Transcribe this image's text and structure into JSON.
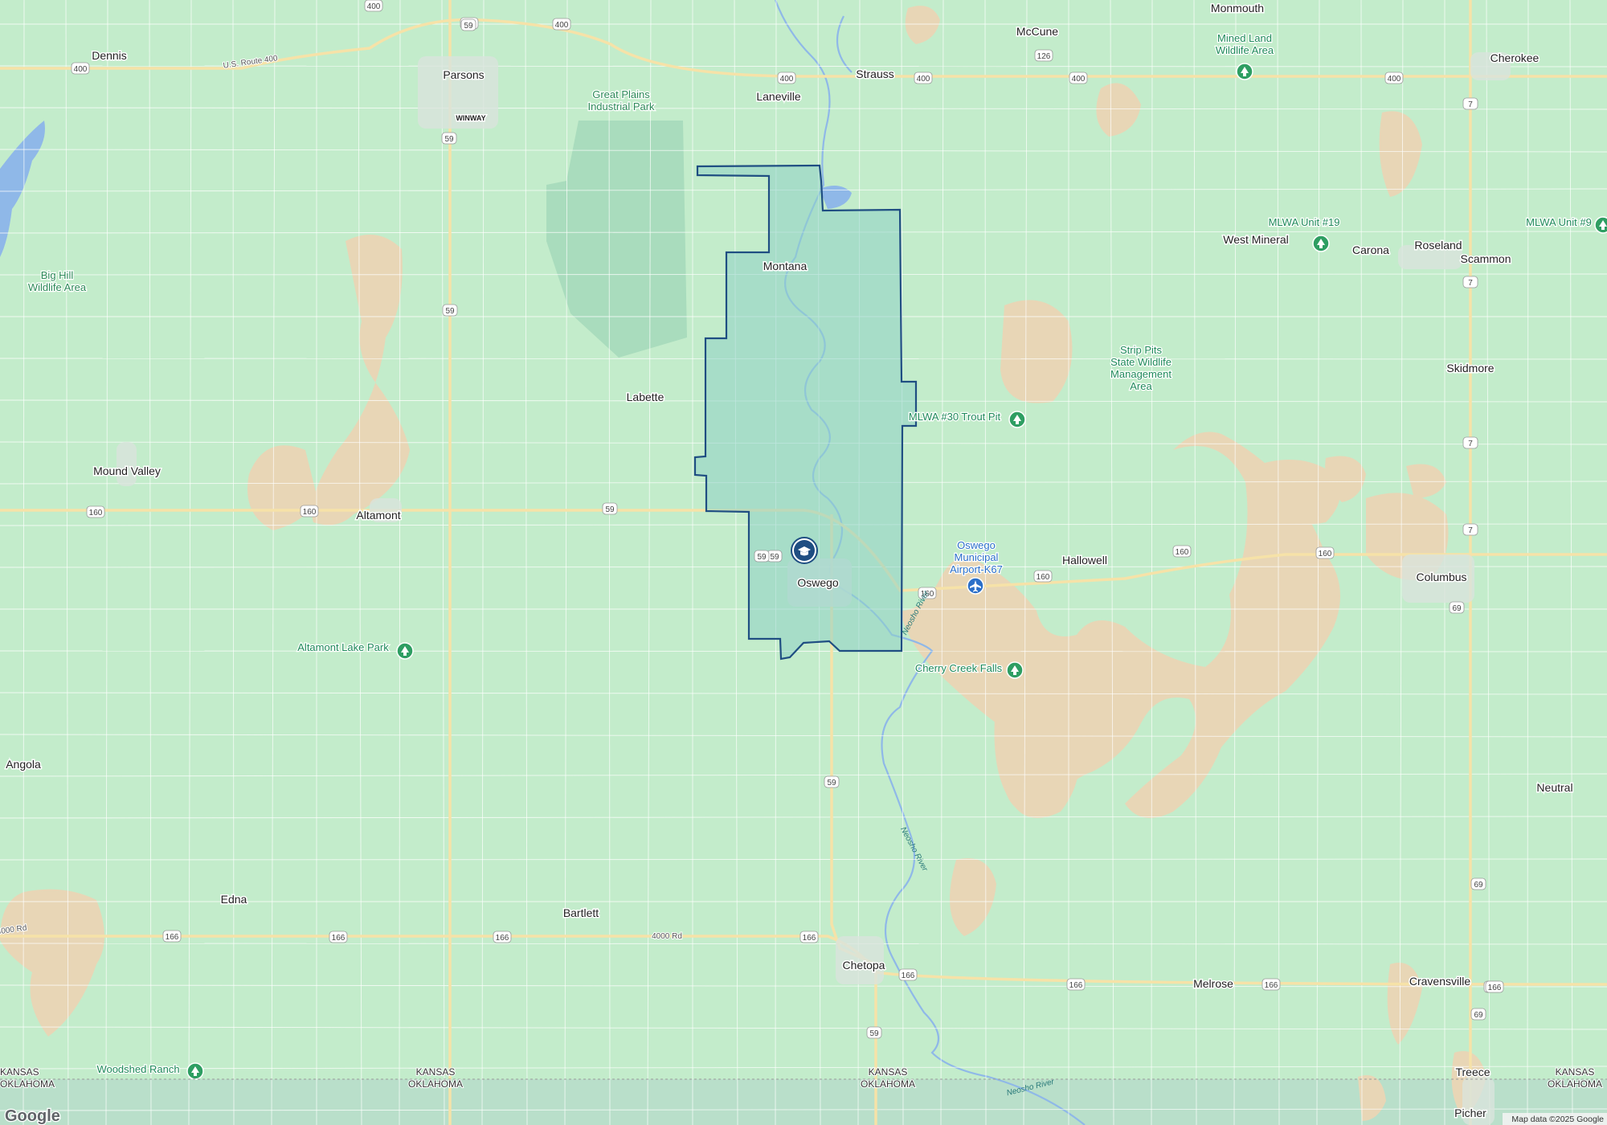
{
  "colors": {
    "land": "#c3eccb",
    "farmland": "#e8d6b6",
    "park": "#a9dcbd",
    "water": "#8fb8e8",
    "road": "#ffffff",
    "highway": "#f6e2a8",
    "district_fill": "#8fd1c7",
    "district_stroke": "#1f4e82",
    "park_text": "#1e8a5a",
    "airport_text": "#2a6fc9",
    "oklahoma_tint": "#b9dfca"
  },
  "towns": [
    {
      "name": "Dennis"
    },
    {
      "name": "Parsons"
    },
    {
      "name": "Winway"
    },
    {
      "name": "Laneville"
    },
    {
      "name": "Strauss"
    },
    {
      "name": "McCune"
    },
    {
      "name": "Monmouth"
    },
    {
      "name": "Cherokee"
    },
    {
      "name": "Montana"
    },
    {
      "name": "West Mineral"
    },
    {
      "name": "Carona"
    },
    {
      "name": "Roseland"
    },
    {
      "name": "Scammon"
    },
    {
      "name": "Skidmore"
    },
    {
      "name": "Labette"
    },
    {
      "name": "Mound Valley"
    },
    {
      "name": "Altamont"
    },
    {
      "name": "Oswego"
    },
    {
      "name": "Hallowell"
    },
    {
      "name": "Columbus"
    },
    {
      "name": "Angola"
    },
    {
      "name": "Neutral"
    },
    {
      "name": "Edna"
    },
    {
      "name": "Bartlett"
    },
    {
      "name": "Chetopa"
    },
    {
      "name": "Melrose"
    },
    {
      "name": "Cravensville"
    },
    {
      "name": "Treece"
    },
    {
      "name": "Picher"
    }
  ],
  "places": [
    {
      "lines": [
        "Great Plains",
        "Industrial Park"
      ],
      "icon": null
    },
    {
      "lines": [
        "Mined Land",
        "Wildlife Area"
      ],
      "icon": "tree-icon"
    },
    {
      "lines": [
        "Big Hill",
        "Wildlife Area"
      ],
      "icon": null
    },
    {
      "lines": [
        "MLWA Unit #19"
      ],
      "icon": "tree-icon"
    },
    {
      "lines": [
        "MLWA Unit #9"
      ],
      "icon": "tree-icon"
    },
    {
      "lines": [
        "Strip Pits",
        "State Wildlife",
        "Management",
        "Area"
      ],
      "icon": null
    },
    {
      "lines": [
        "MLWA #30 Trout Pit"
      ],
      "icon": "tree-icon"
    },
    {
      "lines": [
        "Altamont Lake Park"
      ],
      "icon": "tree-icon"
    },
    {
      "lines": [
        "Cherry Creek Falls"
      ],
      "icon": "tree-icon"
    },
    {
      "lines": [
        "Woodshed Ranch"
      ],
      "icon": "tree-icon"
    }
  ],
  "airport": {
    "lines": [
      "Oswego",
      "Municipal",
      "Airport-K67"
    ],
    "icon": "airplane-icon"
  },
  "school_icon": "graduation-cap-icon",
  "shields": [
    "400",
    "400",
    "400",
    "400",
    "400",
    "400",
    "400",
    "400",
    "59",
    "59",
    "59",
    "59",
    "59",
    "59",
    "126",
    "7",
    "7",
    "7",
    "7",
    "160",
    "160",
    "160",
    "160",
    "160",
    "160",
    "160",
    "69",
    "69",
    "69",
    "166",
    "166",
    "166",
    "166",
    "166",
    "166",
    "166",
    "166",
    "59",
    "59"
  ],
  "road_labels": [
    {
      "text": "U.S. Route 400"
    },
    {
      "text": "4000 Rd"
    },
    {
      "text": "4000 Rd"
    }
  ],
  "rivers": [
    {
      "text": "Neosho River"
    },
    {
      "text": "Neosho River"
    },
    {
      "text": "Neosho River"
    }
  ],
  "state_labels": [
    {
      "top": "KANSAS",
      "bottom": "OKLAHOMA"
    },
    {
      "top": "KANSAS",
      "bottom": "OKLAHOMA"
    },
    {
      "top": "KANSAS",
      "bottom": "OKLAHOMA"
    },
    {
      "top": "KANSAS",
      "bottom": "OKLAHOMA"
    }
  ],
  "attribution": "Map data ©2025 Google",
  "logo": "Google"
}
